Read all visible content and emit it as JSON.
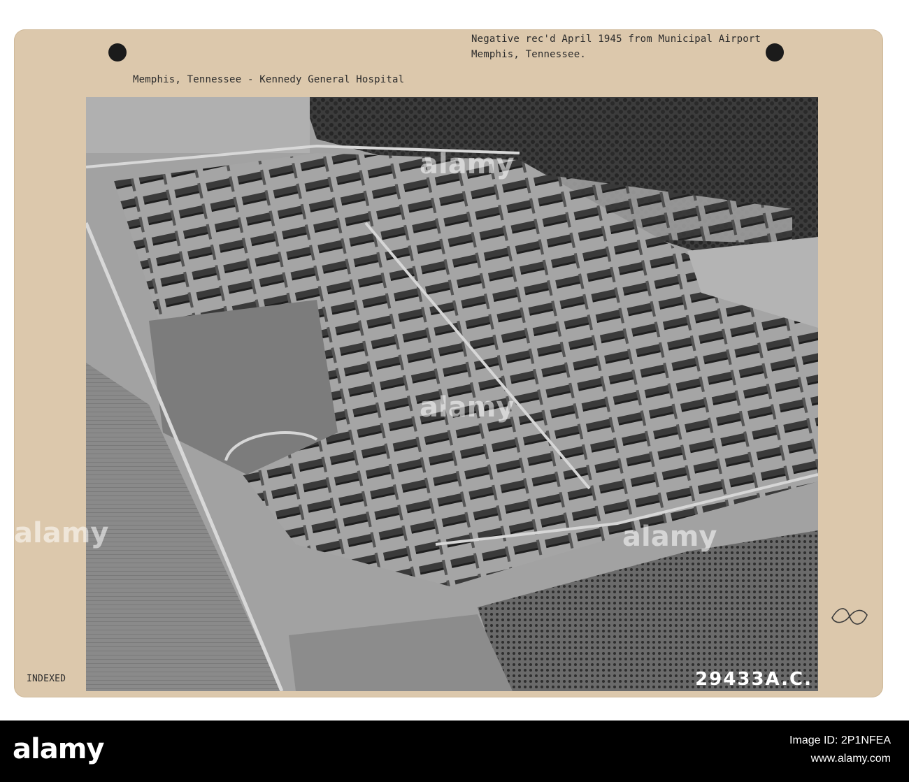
{
  "mount_card": {
    "annotation": "Negative rec'd April 1945 from Municipal Airport",
    "annotation_line2": "Memphis, Tennessee.",
    "caption": "Memphis, Tennessee - Kennedy General Hospital",
    "stamp": "INDEXED",
    "negative_number": "29433A.C."
  },
  "watermark": {
    "brand": "alamy"
  },
  "footer": {
    "brand": "alamy",
    "image_id_label": "Image ID: 2P1NFEA",
    "url": "www.alamy.com"
  }
}
